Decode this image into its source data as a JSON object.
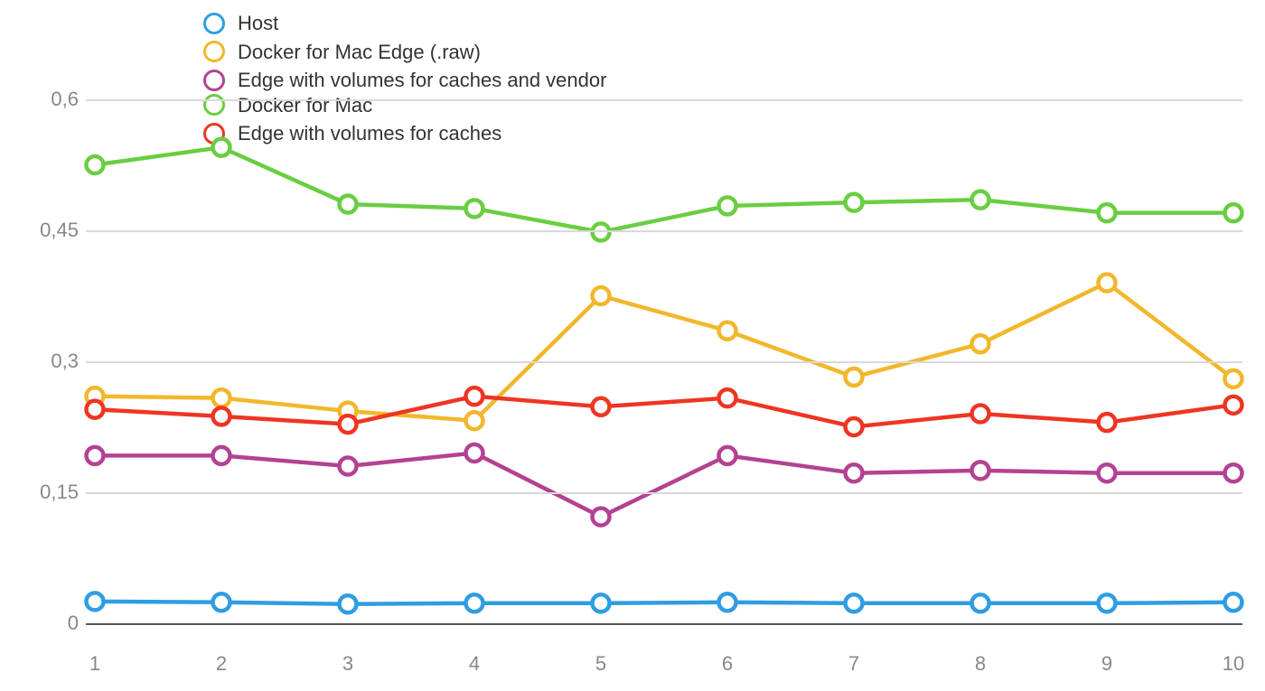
{
  "chart_data": {
    "type": "line",
    "categories": [
      "1",
      "2",
      "3",
      "4",
      "5",
      "6",
      "7",
      "8",
      "9",
      "10"
    ],
    "y_ticks": [
      "0",
      "0,15",
      "0,3",
      "0,45",
      "0,6"
    ],
    "ylim": [
      0,
      0.6
    ],
    "series": [
      {
        "name": "Host",
        "color": "#2f9de3",
        "values": [
          0.025,
          0.024,
          0.022,
          0.023,
          0.023,
          0.024,
          0.023,
          0.023,
          0.023,
          0.024
        ]
      },
      {
        "name": "Docker for Mac",
        "color": "#69ce41",
        "values": [
          0.525,
          0.545,
          0.48,
          0.475,
          0.448,
          0.478,
          0.482,
          0.485,
          0.47,
          0.47
        ]
      },
      {
        "name": "Docker for Mac Edge (.raw)",
        "color": "#f2b72b",
        "values": [
          0.26,
          0.258,
          0.243,
          0.232,
          0.375,
          0.335,
          0.282,
          0.32,
          0.39,
          0.28
        ]
      },
      {
        "name": "Edge with volumes for caches",
        "color": "#ee3523",
        "values": [
          0.245,
          0.237,
          0.228,
          0.26,
          0.248,
          0.258,
          0.225,
          0.24,
          0.23,
          0.25
        ]
      },
      {
        "name": "Edge with volumes for caches and vendor",
        "color": "#b34292",
        "values": [
          0.192,
          0.192,
          0.18,
          0.195,
          0.122,
          0.192,
          0.172,
          0.175,
          0.172,
          0.172
        ]
      }
    ],
    "legend_layout": [
      [
        0,
        2,
        4
      ],
      [
        1,
        3
      ]
    ]
  }
}
